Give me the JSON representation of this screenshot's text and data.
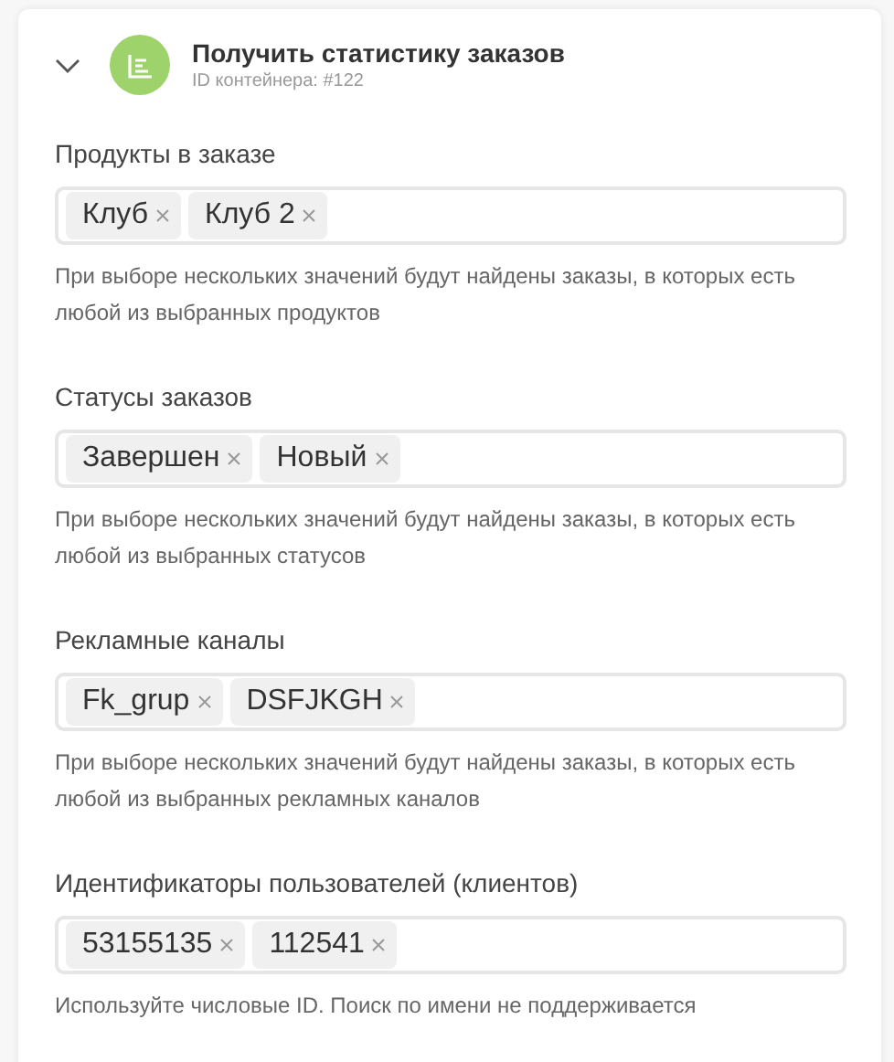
{
  "header": {
    "expanded": true,
    "title": "Получить статистику заказов",
    "subtitle": "ID контейнера: #122"
  },
  "fields": [
    {
      "label": "Продукты в заказе",
      "chips": [
        "Клуб",
        "Клуб 2"
      ],
      "help": "При выборе нескольких значений будут найдены заказы, в которых есть любой из выбранных продуктов"
    },
    {
      "label": "Статусы заказов",
      "chips": [
        "Завершен",
        "Новый"
      ],
      "help": "При выборе нескольких значений будут найдены заказы, в которых есть любой из выбранных статусов"
    },
    {
      "label": "Рекламные каналы",
      "chips": [
        "Fk_grup",
        "DSFJKGH"
      ],
      "help": "При выборе нескольких значений будут найдены заказы, в которых есть любой из выбранных рекламных каналов"
    },
    {
      "label": "Идентификаторы пользователей (клиентов)",
      "chips": [
        "53155135",
        "112541"
      ],
      "help": "Используйте числовые ID. Поиск по имени не поддерживается"
    }
  ]
}
